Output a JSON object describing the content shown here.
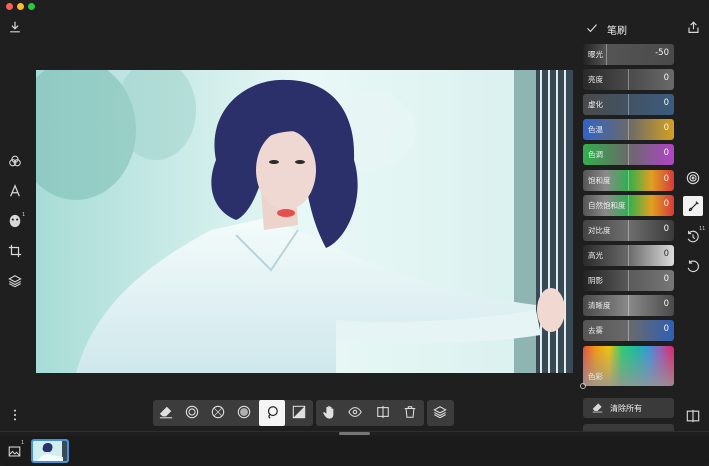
{
  "panel": {
    "title": "笔刷",
    "sliders": [
      {
        "label": "曝光",
        "value": "-50"
      },
      {
        "label": "亮度",
        "value": "0"
      },
      {
        "label": "虚化",
        "value": "0"
      },
      {
        "label": "色温",
        "value": "0"
      },
      {
        "label": "色调",
        "value": "0"
      },
      {
        "label": "饱和度",
        "value": "0"
      },
      {
        "label": "自然饱和度",
        "value": "0"
      },
      {
        "label": "对比度",
        "value": "0"
      },
      {
        "label": "高光",
        "value": "0"
      },
      {
        "label": "阴影",
        "value": "0"
      },
      {
        "label": "清晰度",
        "value": "0"
      },
      {
        "label": "去雾",
        "value": "0"
      }
    ],
    "color_label": "色彩",
    "clear_all_label": "清除所有"
  },
  "badges": {
    "left_mask_count": "1",
    "right_history_count": "11",
    "filmstrip_count": "1"
  },
  "icons": {
    "left": [
      "download-icon",
      "color-filter-icon",
      "text-icon",
      "mask-icon",
      "crop-icon",
      "layers-icon",
      "more-icon"
    ],
    "right": [
      "share-icon",
      "spiral-icon",
      "brush-icon",
      "history-icon",
      "undo-icon",
      "compare-icon"
    ],
    "toolbar": [
      "eraser-icon",
      "radial-icon",
      "radial-inverse-icon",
      "radial-fill-icon",
      "lasso-icon",
      "gradient-icon",
      "hand-icon",
      "eye-icon",
      "split-view-icon",
      "trash-icon",
      "layers-icon"
    ]
  },
  "colors": {
    "accent": "#4a90d9",
    "background": "#1f1f1f",
    "panel_slider": "#3a3a3a"
  }
}
